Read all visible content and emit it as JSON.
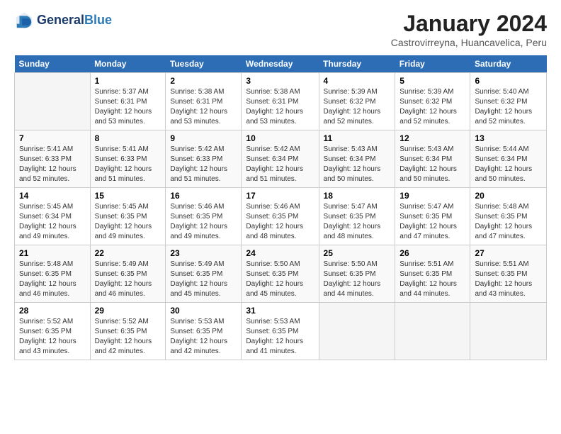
{
  "header": {
    "logo_line1": "General",
    "logo_line2": "Blue",
    "title": "January 2024",
    "location": "Castrovirreyna, Huancavelica, Peru"
  },
  "days_of_week": [
    "Sunday",
    "Monday",
    "Tuesday",
    "Wednesday",
    "Thursday",
    "Friday",
    "Saturday"
  ],
  "weeks": [
    [
      {
        "num": "",
        "info": ""
      },
      {
        "num": "1",
        "info": "Sunrise: 5:37 AM\nSunset: 6:31 PM\nDaylight: 12 hours\nand 53 minutes."
      },
      {
        "num": "2",
        "info": "Sunrise: 5:38 AM\nSunset: 6:31 PM\nDaylight: 12 hours\nand 53 minutes."
      },
      {
        "num": "3",
        "info": "Sunrise: 5:38 AM\nSunset: 6:31 PM\nDaylight: 12 hours\nand 53 minutes."
      },
      {
        "num": "4",
        "info": "Sunrise: 5:39 AM\nSunset: 6:32 PM\nDaylight: 12 hours\nand 52 minutes."
      },
      {
        "num": "5",
        "info": "Sunrise: 5:39 AM\nSunset: 6:32 PM\nDaylight: 12 hours\nand 52 minutes."
      },
      {
        "num": "6",
        "info": "Sunrise: 5:40 AM\nSunset: 6:32 PM\nDaylight: 12 hours\nand 52 minutes."
      }
    ],
    [
      {
        "num": "7",
        "info": "Sunrise: 5:41 AM\nSunset: 6:33 PM\nDaylight: 12 hours\nand 52 minutes."
      },
      {
        "num": "8",
        "info": "Sunrise: 5:41 AM\nSunset: 6:33 PM\nDaylight: 12 hours\nand 51 minutes."
      },
      {
        "num": "9",
        "info": "Sunrise: 5:42 AM\nSunset: 6:33 PM\nDaylight: 12 hours\nand 51 minutes."
      },
      {
        "num": "10",
        "info": "Sunrise: 5:42 AM\nSunset: 6:34 PM\nDaylight: 12 hours\nand 51 minutes."
      },
      {
        "num": "11",
        "info": "Sunrise: 5:43 AM\nSunset: 6:34 PM\nDaylight: 12 hours\nand 50 minutes."
      },
      {
        "num": "12",
        "info": "Sunrise: 5:43 AM\nSunset: 6:34 PM\nDaylight: 12 hours\nand 50 minutes."
      },
      {
        "num": "13",
        "info": "Sunrise: 5:44 AM\nSunset: 6:34 PM\nDaylight: 12 hours\nand 50 minutes."
      }
    ],
    [
      {
        "num": "14",
        "info": "Sunrise: 5:45 AM\nSunset: 6:34 PM\nDaylight: 12 hours\nand 49 minutes."
      },
      {
        "num": "15",
        "info": "Sunrise: 5:45 AM\nSunset: 6:35 PM\nDaylight: 12 hours\nand 49 minutes."
      },
      {
        "num": "16",
        "info": "Sunrise: 5:46 AM\nSunset: 6:35 PM\nDaylight: 12 hours\nand 49 minutes."
      },
      {
        "num": "17",
        "info": "Sunrise: 5:46 AM\nSunset: 6:35 PM\nDaylight: 12 hours\nand 48 minutes."
      },
      {
        "num": "18",
        "info": "Sunrise: 5:47 AM\nSunset: 6:35 PM\nDaylight: 12 hours\nand 48 minutes."
      },
      {
        "num": "19",
        "info": "Sunrise: 5:47 AM\nSunset: 6:35 PM\nDaylight: 12 hours\nand 47 minutes."
      },
      {
        "num": "20",
        "info": "Sunrise: 5:48 AM\nSunset: 6:35 PM\nDaylight: 12 hours\nand 47 minutes."
      }
    ],
    [
      {
        "num": "21",
        "info": "Sunrise: 5:48 AM\nSunset: 6:35 PM\nDaylight: 12 hours\nand 46 minutes."
      },
      {
        "num": "22",
        "info": "Sunrise: 5:49 AM\nSunset: 6:35 PM\nDaylight: 12 hours\nand 46 minutes."
      },
      {
        "num": "23",
        "info": "Sunrise: 5:49 AM\nSunset: 6:35 PM\nDaylight: 12 hours\nand 45 minutes."
      },
      {
        "num": "24",
        "info": "Sunrise: 5:50 AM\nSunset: 6:35 PM\nDaylight: 12 hours\nand 45 minutes."
      },
      {
        "num": "25",
        "info": "Sunrise: 5:50 AM\nSunset: 6:35 PM\nDaylight: 12 hours\nand 44 minutes."
      },
      {
        "num": "26",
        "info": "Sunrise: 5:51 AM\nSunset: 6:35 PM\nDaylight: 12 hours\nand 44 minutes."
      },
      {
        "num": "27",
        "info": "Sunrise: 5:51 AM\nSunset: 6:35 PM\nDaylight: 12 hours\nand 43 minutes."
      }
    ],
    [
      {
        "num": "28",
        "info": "Sunrise: 5:52 AM\nSunset: 6:35 PM\nDaylight: 12 hours\nand 43 minutes."
      },
      {
        "num": "29",
        "info": "Sunrise: 5:52 AM\nSunset: 6:35 PM\nDaylight: 12 hours\nand 42 minutes."
      },
      {
        "num": "30",
        "info": "Sunrise: 5:53 AM\nSunset: 6:35 PM\nDaylight: 12 hours\nand 42 minutes."
      },
      {
        "num": "31",
        "info": "Sunrise: 5:53 AM\nSunset: 6:35 PM\nDaylight: 12 hours\nand 41 minutes."
      },
      {
        "num": "",
        "info": ""
      },
      {
        "num": "",
        "info": ""
      },
      {
        "num": "",
        "info": ""
      }
    ]
  ]
}
